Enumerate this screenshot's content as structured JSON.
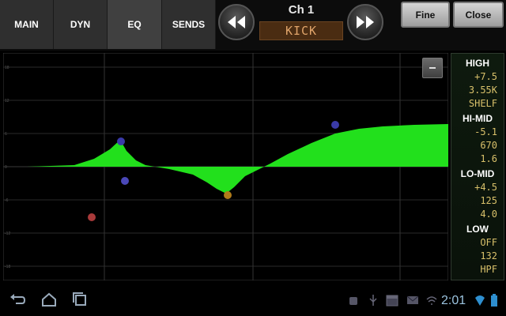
{
  "tabs": [
    {
      "label": "MAIN",
      "active": false
    },
    {
      "label": "DYN",
      "active": false
    },
    {
      "label": "EQ",
      "active": true
    },
    {
      "label": "SENDS",
      "active": false
    }
  ],
  "channel": {
    "label": "Ch 1",
    "name": "KICK"
  },
  "buttons": {
    "fine": "Fine",
    "close": "Close"
  },
  "bands": [
    {
      "name": "HIGH",
      "gain": "+7.5",
      "freq": "3.55K",
      "q": "SHELF"
    },
    {
      "name": "HI-MID",
      "gain": "-5.1",
      "freq": "670",
      "q": "1.6"
    },
    {
      "name": "LO-MID",
      "gain": "+4.5",
      "freq": "125",
      "q": "4.0"
    },
    {
      "name": "LOW",
      "gain": "OFF",
      "freq": "132",
      "q": "HPF"
    }
  ],
  "graph": {
    "y_tick_labels": [
      "18",
      "12",
      "6",
      "0",
      "-6",
      "-12",
      "-18"
    ],
    "fill_color": "#22e01c",
    "points": [
      {
        "band": "HIGH",
        "color": "#3a3aa8"
      },
      {
        "band": "HI-MID",
        "color": "#b07c1a"
      },
      {
        "band": "LO-MID",
        "color": "#4a48b8"
      },
      {
        "band": "LO-MID",
        "color": "#4a48b8"
      },
      {
        "band": "LOW",
        "color": "#a83a3a"
      }
    ]
  },
  "status": {
    "clock": "2:01"
  },
  "icons": {
    "back": "back-icon",
    "home": "home-icon",
    "recent": "recent-apps-icon",
    "menu": "menu-icon",
    "rewind": "rewind-icon",
    "forward": "fast-forward-icon"
  }
}
